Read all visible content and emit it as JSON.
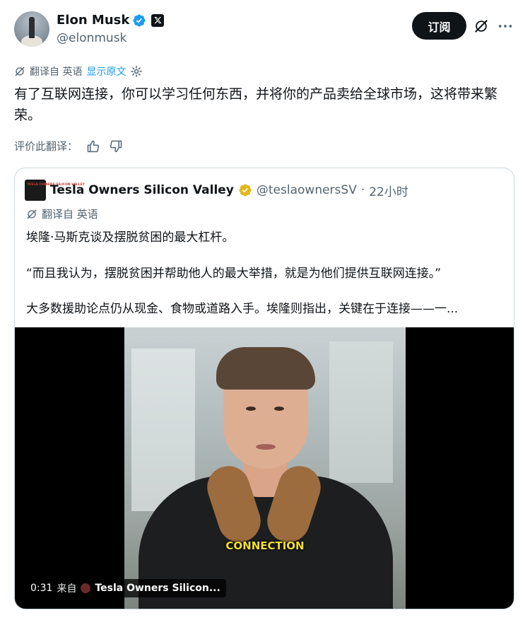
{
  "author": {
    "name": "Elon Musk",
    "handle": "@elonmusk"
  },
  "actions": {
    "subscribe_label": "订阅"
  },
  "translation": {
    "translated_from": "翻译自 英语",
    "show_original": "显示原文"
  },
  "tweet": {
    "text": "有了互联网连接，你可以学习任何东西，并将你的产品卖给全球市场，这将带来繁荣。"
  },
  "rating": {
    "label": "评价此翻译："
  },
  "quote": {
    "avatar_text": "TESLA OWNERS SILICON VALLEY",
    "name": "Tesla Owners Silicon Valley",
    "handle": "@teslaownersSV",
    "separator": "·",
    "time": "22小时",
    "translated_from": "翻译自 英语",
    "paragraphs": [
      "埃隆·马斯克谈及摆脱贫困的最大杠杆。",
      "“而且我认为，摆脱贫困并帮助他人的最大举措，就是为他们提供互联网连接。”",
      "大多数援助论点仍从现金、食物或道路入手。埃隆则指出，关键在于连接——一..."
    ]
  },
  "video": {
    "caption": "CONNECTION",
    "duration": "0:31",
    "from_label": "来自",
    "source_name": "Tesla Owners Silicon..."
  },
  "colors": {
    "text_primary": "#0f1419",
    "text_secondary": "#536471",
    "link": "#1d9bf0",
    "verified_blue": "#1d9bf0",
    "verified_gold": "#e2b719",
    "button_bg": "#0f1419",
    "border": "#cfd9de"
  },
  "icons": {
    "verified": "verified-badge-icon",
    "x_badge": "x-logo-icon",
    "grok": "grok-icon",
    "more": "more-dots-icon",
    "translate": "translate-icon",
    "settings": "gear-icon",
    "like": "thumbs-up-icon",
    "dislike": "thumbs-down-icon"
  }
}
